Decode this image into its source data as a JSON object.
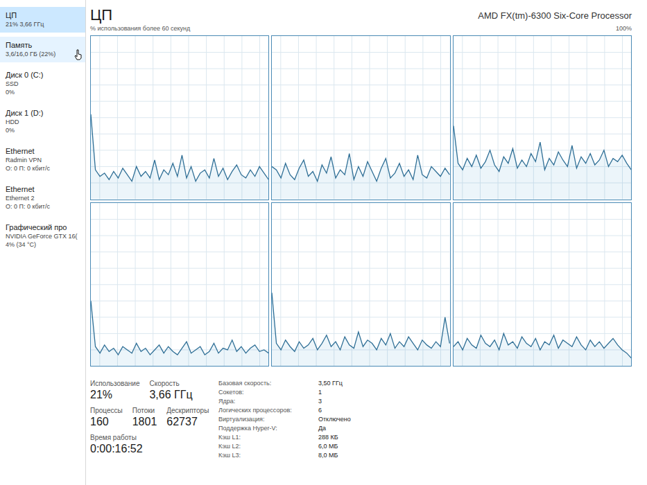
{
  "window": {
    "title": "ЦП",
    "processor": "AMD FX(tm)-6300 Six-Core Processor"
  },
  "sidebar": {
    "items": [
      {
        "name": "ЦП",
        "lines": [
          "21% 3,66 ГГц"
        ],
        "selected": true,
        "highlighted": false
      },
      {
        "name": "Память",
        "lines": [
          "3,6/16,0 ГБ (22%)"
        ],
        "selected": false,
        "highlighted": true
      },
      {
        "name": "Диск 0 (C:)",
        "lines": [
          "SSD",
          "0%"
        ],
        "selected": false,
        "highlighted": false
      },
      {
        "name": "Диск 1 (D:)",
        "lines": [
          "HDD",
          "0%"
        ],
        "selected": false,
        "highlighted": false
      },
      {
        "name": "Ethernet",
        "lines": [
          "Radmin VPN",
          "О: 0 П: 0 кбит/с"
        ],
        "selected": false,
        "highlighted": false
      },
      {
        "name": "Ethernet",
        "lines": [
          "Ethernet 2",
          "О: 0 П: 0 кбит/с"
        ],
        "selected": false,
        "highlighted": false
      },
      {
        "name": "Графический про",
        "lines": [
          "NVIDIA GeForce GTX 16(",
          "4% (34 °C)"
        ],
        "selected": false,
        "highlighted": false
      }
    ]
  },
  "chart": {
    "caption": "% использования более 60 секунд",
    "max_label": "100%",
    "y_max": 100,
    "series": [
      {
        "values": [
          52,
          18,
          14,
          16,
          12,
          17,
          13,
          19,
          15,
          11,
          20,
          14,
          17,
          13,
          24,
          12,
          18,
          15,
          22,
          14,
          27,
          13,
          20,
          11,
          16,
          18,
          13,
          25,
          14,
          19,
          12,
          17,
          21,
          15,
          13,
          18,
          14,
          20,
          16,
          12
        ]
      },
      {
        "values": [
          20,
          18,
          13,
          22,
          15,
          12,
          19,
          24,
          14,
          17,
          11,
          21,
          16,
          26,
          13,
          18,
          15,
          28,
          12,
          20,
          14,
          23,
          17,
          11,
          19,
          25,
          13,
          16,
          22,
          14,
          18,
          12,
          27,
          15,
          13,
          20,
          17,
          14,
          19,
          15
        ]
      },
      {
        "values": [
          45,
          22,
          18,
          25,
          20,
          27,
          19,
          23,
          30,
          21,
          17,
          26,
          22,
          31,
          19,
          24,
          20,
          28,
          23,
          35,
          18,
          25,
          21,
          29,
          24,
          20,
          33,
          19,
          26,
          22,
          28,
          21,
          24,
          30,
          20,
          25,
          23,
          27,
          22,
          18
        ]
      },
      {
        "values": [
          40,
          12,
          8,
          13,
          9,
          11,
          7,
          12,
          10,
          8,
          14,
          9,
          11,
          7,
          10,
          13,
          8,
          12,
          9,
          7,
          11,
          15,
          8,
          10,
          12,
          7,
          9,
          14,
          8,
          11,
          10,
          16,
          9,
          12,
          8,
          11,
          13,
          9,
          10,
          8
        ]
      },
      {
        "values": [
          45,
          14,
          10,
          16,
          12,
          9,
          15,
          11,
          13,
          17,
          10,
          14,
          19,
          12,
          15,
          10,
          18,
          13,
          11,
          21,
          12,
          16,
          14,
          10,
          17,
          13,
          20,
          11,
          15,
          12,
          18,
          14,
          10,
          16,
          13,
          11,
          15,
          12,
          30,
          14
        ]
      },
      {
        "values": [
          12,
          15,
          10,
          17,
          13,
          11,
          19,
          14,
          12,
          16,
          10,
          20,
          13,
          15,
          11,
          18,
          14,
          12,
          17,
          10,
          15,
          13,
          19,
          11,
          16,
          14,
          12,
          18,
          13,
          10,
          16,
          12,
          15,
          11,
          14,
          17,
          13,
          10,
          8,
          5
        ]
      }
    ]
  },
  "stats": {
    "primary": [
      {
        "label": "Использование",
        "value": "21%"
      },
      {
        "label": "Скорость",
        "value": "3,66 ГГц"
      }
    ],
    "secondary": [
      {
        "label": "Процессы",
        "value": "160"
      },
      {
        "label": "Потоки",
        "value": "1801"
      },
      {
        "label": "Дескрипторы",
        "value": "62737"
      }
    ],
    "uptime": {
      "label": "Время работы",
      "value": "0:00:16:52"
    }
  },
  "specs": [
    {
      "label": "Базовая скорость:",
      "value": "3,50 ГГц"
    },
    {
      "label": "Сокетов:",
      "value": "1"
    },
    {
      "label": "Ядра:",
      "value": "3"
    },
    {
      "label": "Логических процессоров:",
      "value": "6"
    },
    {
      "label": "Виртуализация:",
      "value": "Отключено"
    },
    {
      "label": "Поддержка Hyper-V:",
      "value": "Да"
    },
    {
      "label": "Кэш L1:",
      "value": "288 КБ"
    },
    {
      "label": "Кэш L2:",
      "value": "6,0 МБ"
    },
    {
      "label": "Кэш L3:",
      "value": "8,0 МБ"
    }
  ]
}
